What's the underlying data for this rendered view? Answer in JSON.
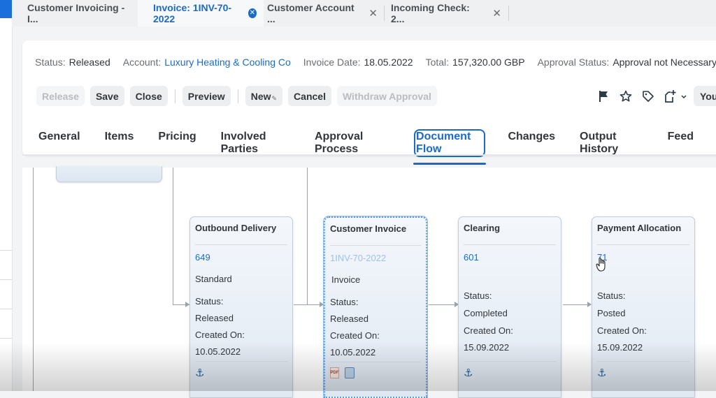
{
  "tabs": [
    {
      "label": "Customer Invoicing - I...",
      "active": false,
      "closable": false
    },
    {
      "label": "Invoice: 1INV-70-2022",
      "active": true,
      "closable": true
    },
    {
      "label": "Customer Account ...",
      "active": false,
      "closable": true
    },
    {
      "label": "Incoming Check: 2...",
      "active": false,
      "closable": true
    }
  ],
  "header": {
    "attributes": [
      {
        "label": "Status:",
        "value": "Released",
        "link": false
      },
      {
        "label": "Account:",
        "value": "Luxury Heating & Cooling Co",
        "link": true
      },
      {
        "label": "Invoice Date:",
        "value": "18.05.2022",
        "link": false
      },
      {
        "label": "Total:",
        "value": "157,320.00 GBP",
        "link": false
      },
      {
        "label": "Approval Status:",
        "value": "Approval not Necessary",
        "link": false
      }
    ],
    "toolbar": {
      "release": "Release",
      "save": "Save",
      "close": "Close",
      "preview": "Preview",
      "new": "New",
      "cancel": "Cancel",
      "withdraw_approval": "Withdraw Approval",
      "you": "You"
    },
    "icons": [
      "flag-icon",
      "star-icon",
      "tag-icon",
      "add-document-icon",
      "chevron-down-icon"
    ],
    "nav_tabs": [
      "General",
      "Items",
      "Pricing",
      "Involved Parties",
      "Approval Process",
      "Document Flow",
      "Changes",
      "Output History",
      "Feed"
    ],
    "selected_tab": "Document Flow"
  },
  "document_flow": {
    "nodes": [
      {
        "title": "Outbound Delivery",
        "id": "649",
        "type": "Standard",
        "status_label": "Status:",
        "status": "Released",
        "created_label": "Created On:",
        "created": "10.05.2022",
        "footer_icons": [
          "anchor-icon"
        ]
      },
      {
        "title": "Customer Invoice",
        "id": "1INV-70-2022",
        "type": "Invoice",
        "status_label": "Status:",
        "status": "Released",
        "created_label": "Created On:",
        "created": "10.05.2022",
        "footer_icons": [
          "pdf-icon",
          "print-icon"
        ],
        "selected": true
      },
      {
        "title": "Clearing",
        "id": "601",
        "type": "",
        "status_label": "Status:",
        "status": "Completed",
        "created_label": "Created On:",
        "created": "15.09.2022",
        "footer_icons": [
          "anchor-icon"
        ]
      },
      {
        "title": "Payment Allocation",
        "id": "71",
        "type": "",
        "status_label": "Status:",
        "status": "Posted",
        "created_label": "Created On:",
        "created": "15.09.2022",
        "footer_icons": [
          "anchor-icon"
        ]
      }
    ]
  },
  "colors": {
    "accent": "#1a6bc7",
    "link": "#1a6bc7",
    "text": "#32363a",
    "label": "#6a6d70"
  }
}
